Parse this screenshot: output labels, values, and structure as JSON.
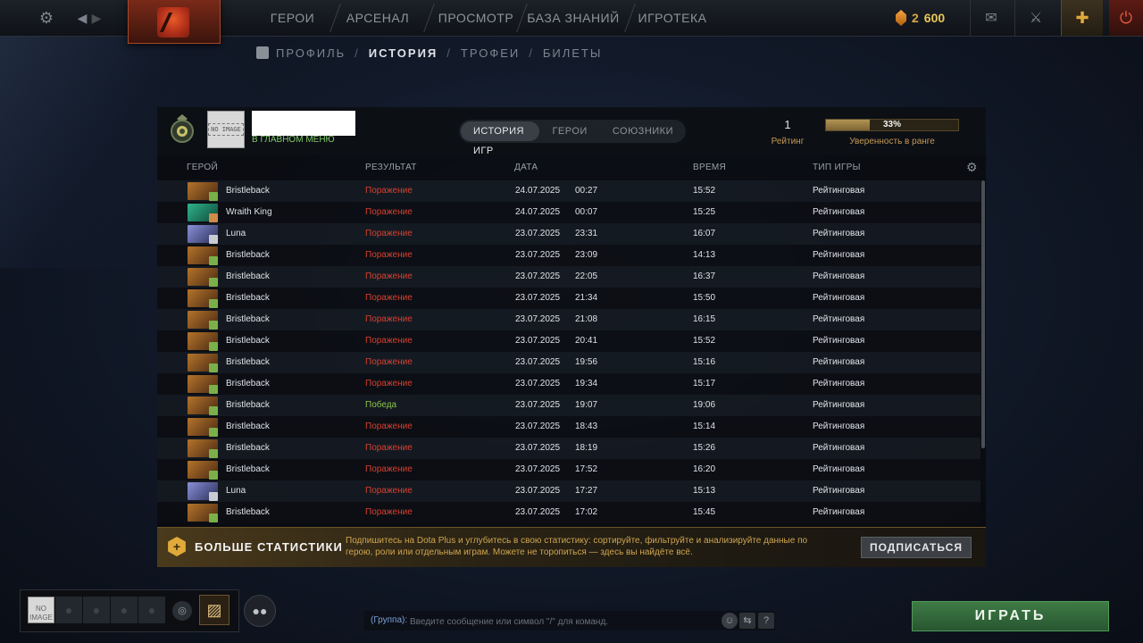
{
  "topbar": {
    "nav": [
      "ГЕРОИ",
      "АРСЕНАЛ",
      "ПРОСМОТР",
      "БАЗА ЗНАНИЙ",
      "ИГРОТЕКА"
    ],
    "shards_count": "2",
    "currency_value": "600",
    "icons": [
      "gear-icon",
      "back-arrow-icon",
      "forward-arrow-icon",
      "mail-icon",
      "armory-icon",
      "dota-plus-icon",
      "power-icon"
    ]
  },
  "subnav": {
    "profile": "ПРОФИЛЬ",
    "history": "ИСТОРИЯ",
    "trophies": "ТРОФЕИ",
    "tickets": "БИЛЕТЫ",
    "sep": "/"
  },
  "player": {
    "status": "В ГЛАВНОМ МЕНЮ",
    "avatar_text": "NO IMAGE"
  },
  "tabs": [
    "ИСТОРИЯ ИГР",
    "ГЕРОИ",
    "СОЮЗНИКИ"
  ],
  "rating": {
    "value": "1",
    "label": "Рейтинг",
    "confidence_pct": 33,
    "confidence_text": "33%",
    "confidence_label": "Уверенность в ранге"
  },
  "columns": {
    "hero": "ГЕРОЙ",
    "result": "РЕЗУЛЬТАТ",
    "date": "ДАТА",
    "duration": "ВРЕМЯ",
    "type": "ТИП ИГРЫ"
  },
  "matches": [
    {
      "hero": "Bristleback",
      "result": "Поражение",
      "win": false,
      "date": "24.07.2025",
      "time": "00:27",
      "duration": "15:52",
      "type": "Рейтинговая"
    },
    {
      "hero": "Wraith King",
      "result": "Поражение",
      "win": false,
      "date": "24.07.2025",
      "time": "00:07",
      "duration": "15:25",
      "type": "Рейтинговая"
    },
    {
      "hero": "Luna",
      "result": "Поражение",
      "win": false,
      "date": "23.07.2025",
      "time": "23:31",
      "duration": "16:07",
      "type": "Рейтинговая"
    },
    {
      "hero": "Bristleback",
      "result": "Поражение",
      "win": false,
      "date": "23.07.2025",
      "time": "23:09",
      "duration": "14:13",
      "type": "Рейтинговая"
    },
    {
      "hero": "Bristleback",
      "result": "Поражение",
      "win": false,
      "date": "23.07.2025",
      "time": "22:05",
      "duration": "16:37",
      "type": "Рейтинговая"
    },
    {
      "hero": "Bristleback",
      "result": "Поражение",
      "win": false,
      "date": "23.07.2025",
      "time": "21:34",
      "duration": "15:50",
      "type": "Рейтинговая"
    },
    {
      "hero": "Bristleback",
      "result": "Поражение",
      "win": false,
      "date": "23.07.2025",
      "time": "21:08",
      "duration": "16:15",
      "type": "Рейтинговая"
    },
    {
      "hero": "Bristleback",
      "result": "Поражение",
      "win": false,
      "date": "23.07.2025",
      "time": "20:41",
      "duration": "15:52",
      "type": "Рейтинговая"
    },
    {
      "hero": "Bristleback",
      "result": "Поражение",
      "win": false,
      "date": "23.07.2025",
      "time": "19:56",
      "duration": "15:16",
      "type": "Рейтинговая"
    },
    {
      "hero": "Bristleback",
      "result": "Поражение",
      "win": false,
      "date": "23.07.2025",
      "time": "19:34",
      "duration": "15:17",
      "type": "Рейтинговая"
    },
    {
      "hero": "Bristleback",
      "result": "Победа",
      "win": true,
      "date": "23.07.2025",
      "time": "19:07",
      "duration": "19:06",
      "type": "Рейтинговая"
    },
    {
      "hero": "Bristleback",
      "result": "Поражение",
      "win": false,
      "date": "23.07.2025",
      "time": "18:43",
      "duration": "15:14",
      "type": "Рейтинговая"
    },
    {
      "hero": "Bristleback",
      "result": "Поражение",
      "win": false,
      "date": "23.07.2025",
      "time": "18:19",
      "duration": "15:26",
      "type": "Рейтинговая"
    },
    {
      "hero": "Bristleback",
      "result": "Поражение",
      "win": false,
      "date": "23.07.2025",
      "time": "17:52",
      "duration": "16:20",
      "type": "Рейтинговая"
    },
    {
      "hero": "Luna",
      "result": "Поражение",
      "win": false,
      "date": "23.07.2025",
      "time": "17:27",
      "duration": "15:13",
      "type": "Рейтинговая"
    },
    {
      "hero": "Bristleback",
      "result": "Поражение",
      "win": false,
      "date": "23.07.2025",
      "time": "17:02",
      "duration": "15:45",
      "type": "Рейтинговая"
    }
  ],
  "hero_colors": {
    "Bristleback": [
      "#b5742a",
      "#4a2a14"
    ],
    "Wraith King": [
      "#2fb38a",
      "#0f4a3a"
    ],
    "Luna": [
      "#8a90d8",
      "#2a2f5a"
    ]
  },
  "promo": {
    "title": "БОЛЬШЕ СТАТИСТИКИ",
    "text": "Подпишитесь на Dota Plus и углубитесь в свою статистику: сортируйте, фильтруйте и анализируйте данные по герою, роли или отдельным играм. Можете не торопиться — здесь вы найдёте всё.",
    "button": "ПОДПИСАТЬСЯ",
    "icon_glyph": "+"
  },
  "chat": {
    "channel": "(Группа):",
    "placeholder": "Введите сообщение или символ \"/\" для команд."
  },
  "play_button": "ИГРАТЬ"
}
